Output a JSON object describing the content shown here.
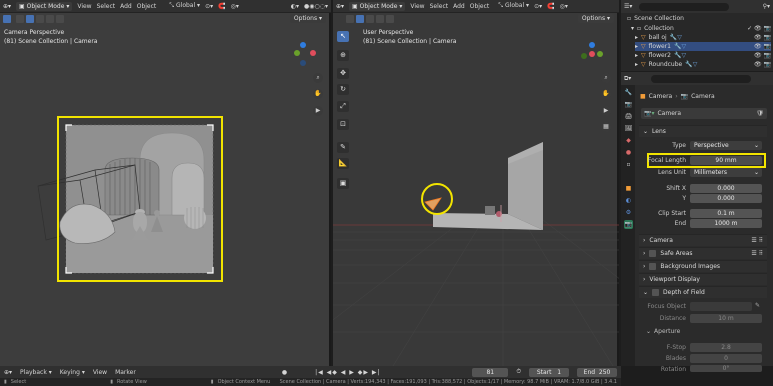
{
  "left_viewport": {
    "header": {
      "mode": "Object Mode",
      "menus": [
        "View",
        "Select",
        "Add",
        "Object"
      ],
      "transform": "Global",
      "options": "Options"
    },
    "title": "Camera Perspective",
    "subtitle": "(81) Scene Collection | Camera"
  },
  "right_viewport": {
    "header": {
      "mode": "Object Mode",
      "menus": [
        "View",
        "Select",
        "Add",
        "Object"
      ],
      "transform": "Global",
      "options": "Options"
    },
    "title": "User Perspective",
    "subtitle": "(81) Scene Collection | Camera"
  },
  "outliner": {
    "scene_collection": "Scene Collection",
    "collection": "Collection",
    "items": [
      "ball oj",
      "flower1",
      "flower2",
      "Roundcube"
    ]
  },
  "properties": {
    "breadcrumb": [
      "Camera",
      "Camera"
    ],
    "datablock": "Camera",
    "lens_section": "Lens",
    "type_label": "Type",
    "type_value": "Perspective",
    "focal_label": "Focal Length",
    "focal_value": "90 mm",
    "lens_unit_label": "Lens Unit",
    "lens_unit_value": "Millimeters",
    "shift_x_label": "Shift X",
    "shift_x_value": "0.000",
    "shift_y_label": "Y",
    "shift_y_value": "0.000",
    "clip_start_label": "Clip Start",
    "clip_start_value": "0.1 m",
    "clip_end_label": "End",
    "clip_end_value": "1000 m",
    "sections": [
      "Camera",
      "Safe Areas",
      "Background Images",
      "Viewport Display",
      "Depth of Field"
    ],
    "focus_object_label": "Focus Object",
    "distance_label": "Distance",
    "distance_value": "10 m",
    "aperture_label": "Aperture",
    "fstop_label": "F-Stop",
    "fstop_value": "2.8",
    "blades_label": "Blades",
    "blades_value": "0",
    "rotation_label": "Rotation",
    "rotation_value": "0°"
  },
  "timeline": {
    "menus": [
      "Playback",
      "Keying",
      "View",
      "Marker"
    ],
    "current_frame": "81",
    "start_label": "Start",
    "start_value": "1",
    "end_label": "End",
    "end_value": "250"
  },
  "statusbar": {
    "select": "Select",
    "rotate": "Rotate View",
    "context": "Object Context Menu",
    "stats": "Scene Collection | Camera | Verts:194,343 | Faces:191,093 | Tris:388,572 | Objects:1/17 | Memory: 98.7 MiB | VRAM: 1.7/8.0 GiB | 3.4.1"
  },
  "colors": {
    "highlight": "#f2e400",
    "accent": "#4772b3"
  }
}
